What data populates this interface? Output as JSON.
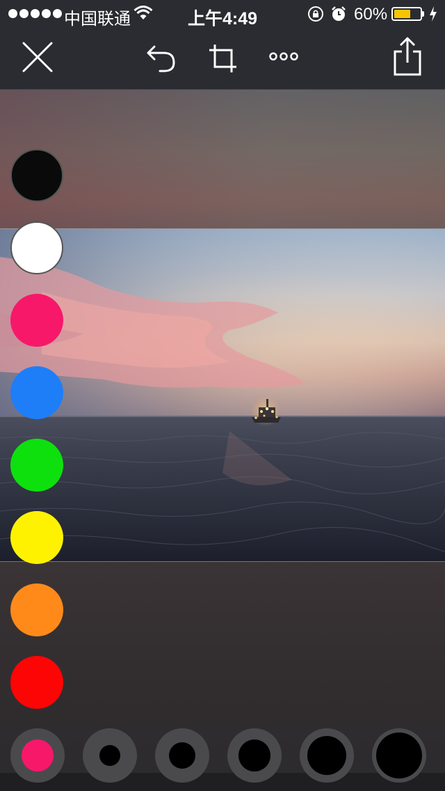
{
  "status_bar": {
    "carrier": "中国联通",
    "time": "上午4:49",
    "battery_percent": "60%",
    "battery_level": 0.6,
    "icons": [
      "signal-dots",
      "wifi-icon",
      "rotation-lock-icon",
      "alarm-icon",
      "battery-icon",
      "charging-icon"
    ]
  },
  "toolbar": {
    "buttons": [
      "close-icon",
      "undo-icon",
      "crop-icon",
      "more-icon",
      "share-icon"
    ]
  },
  "palette": {
    "colors": [
      "#0a0a0a",
      "#ffffff",
      "#f7186a",
      "#1e7ef8",
      "#0ee00e",
      "#fff200",
      "#ff8a1a",
      "#fe0505"
    ],
    "selected": "#f7186a"
  },
  "brush_sizes": {
    "count": 6,
    "selected_index": 0,
    "selected_color": "#f7186a"
  }
}
